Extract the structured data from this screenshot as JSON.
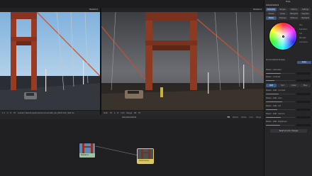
{
  "viewer_left": {
    "name": "MediaIn1"
  },
  "viewer_right": {
    "name": "MediaIn1"
  },
  "left_controls": [
    "1:1",
    "A",
    "B",
    "Fit",
    "Loaded | Backdrops/Production/Cinema4K_GG_0018 0:00 | 900 ms"
  ],
  "right_controls": [
    "Subh",
    "Fit",
    "A",
    "B",
    "3:00",
    "Range",
    "BP",
    "Fit"
  ],
  "node_editor": {
    "title": "ColorCorrector1",
    "tools": [
      "Fit",
      "Options",
      "Modes",
      "Color",
      "Merge"
    ],
    "nodes": [
      {
        "label": "MediaIn1"
      },
      {
        "label": "ColorCorrec."
      }
    ]
  },
  "inspector": {
    "header": "Tools",
    "node_name": "ColorCorrector1",
    "tabs1": [
      "Correction",
      "Ranges",
      "Options",
      "Settings"
    ],
    "tabs2": [
      "Wheels",
      "Levels",
      "Histogram",
      "Suppress"
    ],
    "tabs3": [
      "Master",
      "Shadows",
      "Midtones",
      "Highlights"
    ],
    "wheel_labels": [
      "Hue",
      "Saturation",
      "Tint",
      "Strength",
      "Luminance"
    ],
    "section1": [
      "Pre-Divide/Post-Multiply",
      "Apply",
      "Master - Saturation",
      "Master - Contrast"
    ],
    "rgb_tabs": [
      "RGB",
      "Red",
      "Green",
      "Blue"
    ],
    "params": [
      "Master - RGB - Contrast",
      "Master - RGB - Gain",
      "Master - RGB - Lift",
      "Master - RGB - Gamma",
      "Master - RGB - Brightness"
    ],
    "reset_label": "Reset all color changes",
    "colors": {
      "selected_tab": "#3d5a86",
      "node_border": "#e0d070"
    }
  }
}
